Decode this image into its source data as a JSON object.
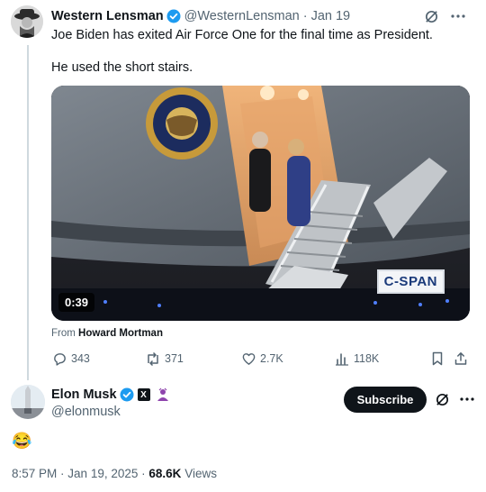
{
  "quoted_post": {
    "author_name": "Western Lensman",
    "handle": "@WesternLensman",
    "date": "Jan 19",
    "text_line1": "Joe Biden has exited Air Force One for the final time as President.",
    "text_line2": "He used the short stairs.",
    "video_duration": "0:39",
    "video_watermark": "C-SPAN",
    "from_prefix": "From",
    "from_name": "Howard Mortman",
    "stats": {
      "replies": "343",
      "reposts": "371",
      "likes": "2.7K",
      "views": "118K"
    }
  },
  "main_post": {
    "author_name": "Elon Musk",
    "handle": "@elonmusk",
    "subscribe_label": "Subscribe",
    "text": "😂",
    "time": "8:57 PM",
    "date": "Jan 19, 2025",
    "views_count": "68.6K",
    "views_label": "Views"
  },
  "colors": {
    "verified_blue": "#1d9bf0",
    "text_primary": "#0f1419",
    "text_secondary": "#536471",
    "grok_purple": "#8e44ad"
  },
  "icons": [
    "grok-icon",
    "more-icon",
    "verified-icon",
    "reply-icon",
    "repost-icon",
    "like-icon",
    "views-icon",
    "bookmark-icon",
    "share-icon",
    "x-badge-icon",
    "affiliate-icon"
  ]
}
